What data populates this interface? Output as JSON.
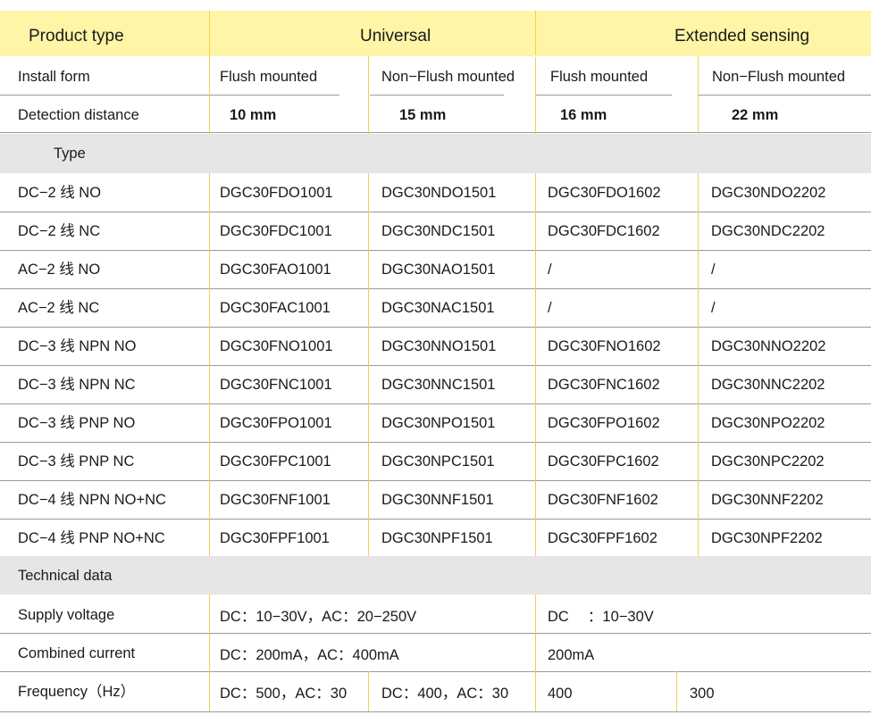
{
  "header": {
    "product_type": "Product type",
    "universal": "Universal",
    "extended": "Extended sensing"
  },
  "install_form": {
    "label": "Install form",
    "values": [
      "Flush mounted",
      "Non−Flush mounted",
      "Flush mounted",
      "Non−Flush mounted"
    ]
  },
  "detection_distance": {
    "label": "Detection distance",
    "values": [
      "10 mm",
      "15 mm",
      "16 mm",
      "22 mm"
    ]
  },
  "type_section": "Type",
  "type_rows": [
    {
      "label": "DC−2 线 NO",
      "models": [
        "DGC30FDO1001",
        "DGC30NDO1501",
        "DGC30FDO1602",
        "DGC30NDO2202"
      ]
    },
    {
      "label": "DC−2 线 NC",
      "models": [
        "DGC30FDC1001",
        "DGC30NDC1501",
        "DGC30FDC1602",
        "DGC30NDC2202"
      ]
    },
    {
      "label": "AC−2 线 NO",
      "models": [
        "DGC30FAO1001",
        "DGC30NAO1501",
        "/",
        "/"
      ]
    },
    {
      "label": "AC−2 线 NC",
      "models": [
        "DGC30FAC1001",
        "DGC30NAC1501",
        "/",
        "/"
      ]
    },
    {
      "label": "DC−3 线 NPN NO",
      "models": [
        "DGC30FNO1001",
        "DGC30NNO1501",
        "DGC30FNO1602",
        "DGC30NNO2202"
      ]
    },
    {
      "label": "DC−3 线 NPN NC",
      "models": [
        "DGC30FNC1001",
        "DGC30NNC1501",
        "DGC30FNC1602",
        "DGC30NNC2202"
      ]
    },
    {
      "label": "DC−3 线 PNP NO",
      "models": [
        "DGC30FPO1001",
        "DGC30NPO1501",
        "DGC30FPO1602",
        "DGC30NPO2202"
      ]
    },
    {
      "label": "DC−3 线 PNP NC",
      "models": [
        "DGC30FPC1001",
        "DGC30NPC1501",
        "DGC30FPC1602",
        "DGC30NPC2202"
      ]
    },
    {
      "label": "DC−4 线 NPN NO+NC",
      "models": [
        "DGC30FNF1001",
        "DGC30NNF1501",
        "DGC30FNF1602",
        "DGC30NNF2202"
      ]
    },
    {
      "label": "DC−4 线 PNP NO+NC",
      "models": [
        "DGC30FPF1001",
        "DGC30NPF1501",
        "DGC30FPF1602",
        "DGC30NPF2202"
      ]
    }
  ],
  "technical_section": "Technical data",
  "technical": {
    "supply_voltage": {
      "label": "Supply voltage",
      "universal": "DC：10−30V，AC：20−250V",
      "extended": "DC 　：10−30V"
    },
    "combined_current": {
      "label": "Combined current",
      "universal": "DC：200mA，AC：400mA",
      "extended": "200mA"
    },
    "frequency": {
      "label": "Frequency（Hz）",
      "values": [
        "DC：500，AC：30",
        "DC：400，AC：30",
        "400",
        "300"
      ]
    }
  }
}
